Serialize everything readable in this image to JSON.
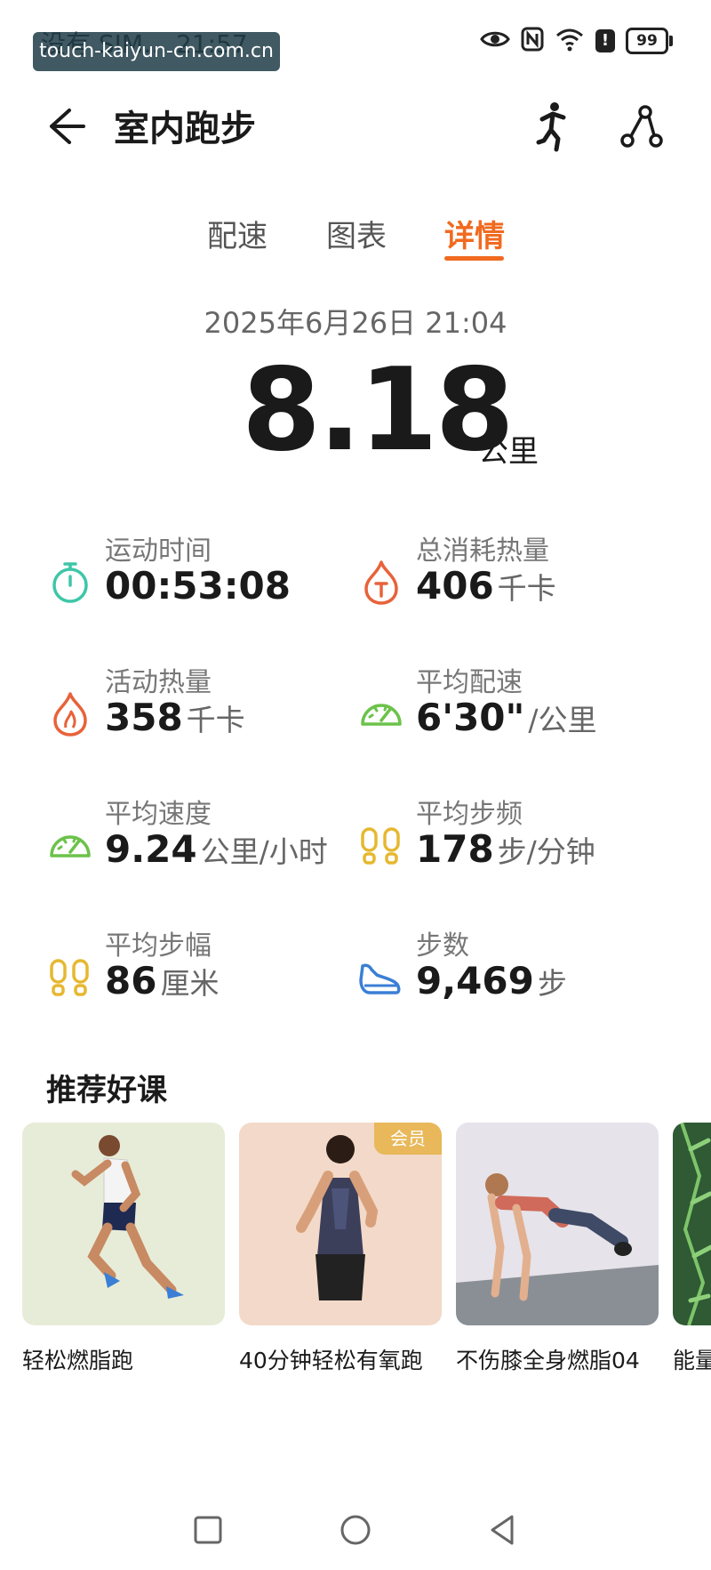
{
  "status_bar": {
    "carrier_time": "没有 SIM… 21:57",
    "battery": "99",
    "watermark": "touch-kaiyun-cn.com.cn",
    "alert_symbol": "!"
  },
  "header": {
    "title": "室内跑步"
  },
  "tabs": [
    {
      "label": "配速"
    },
    {
      "label": "图表"
    },
    {
      "label": "详情",
      "active": true
    }
  ],
  "summary": {
    "date": "2025年6月26日 21:04",
    "distance": "8.18",
    "distance_unit": "公里"
  },
  "stats": [
    {
      "label": "运动时间",
      "value": "00:53:08",
      "unit": "",
      "icon": "stopwatch-icon",
      "color": "#3ec6a8"
    },
    {
      "label": "总消耗热量",
      "value": "406",
      "unit": "千卡",
      "icon": "calorie-flame-icon",
      "color": "#e8623a"
    },
    {
      "label": "活动热量",
      "value": "358",
      "unit": "千卡",
      "icon": "flame-icon",
      "color": "#e8623a"
    },
    {
      "label": "平均配速",
      "value": "6'30\"",
      "unit": "/公里",
      "icon": "speedometer-icon",
      "color": "#6cc24a"
    },
    {
      "label": "平均速度",
      "value": "9.24",
      "unit": "公里/小时",
      "icon": "speedometer-icon",
      "color": "#6cc24a"
    },
    {
      "label": "平均步频",
      "value": "178",
      "unit": "步/分钟",
      "icon": "footprints-icon",
      "color": "#e6b830"
    },
    {
      "label": "平均步幅",
      "value": "86",
      "unit": "厘米",
      "icon": "footprints-icon",
      "color": "#e6b830"
    },
    {
      "label": "步数",
      "value": "9,469",
      "unit": "步",
      "icon": "shoe-icon",
      "color": "#3a7fd5"
    }
  ],
  "recommended": {
    "title": "推荐好课",
    "courses": [
      {
        "label": "轻松燃脂跑",
        "badge": ""
      },
      {
        "label": "40分钟轻松有氧跑",
        "badge": "会员"
      },
      {
        "label": "不伤膝全身燃脂04",
        "badge": ""
      },
      {
        "label": "能量",
        "badge": ""
      }
    ]
  },
  "colors": {
    "accent": "#f06a1f",
    "text_primary": "#1a1a1a",
    "text_secondary": "#777777"
  }
}
